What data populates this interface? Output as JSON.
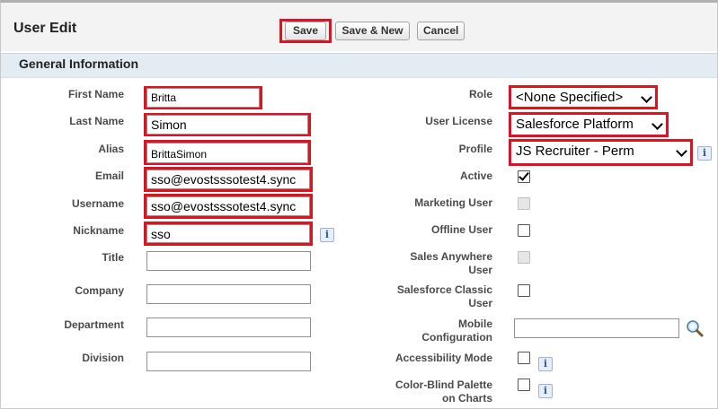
{
  "page": {
    "title": "User Edit",
    "section_title": "General Information"
  },
  "toolbar": {
    "save_label": "Save",
    "save_new_label": "Save & New",
    "cancel_label": "Cancel"
  },
  "left_fields": {
    "first_name": {
      "label": "First Name",
      "value": "Britta"
    },
    "last_name": {
      "label": "Last Name",
      "value": "Simon"
    },
    "alias": {
      "label": "Alias",
      "value": "BrittaSimon"
    },
    "email": {
      "label": "Email",
      "value": "sso@evostsssotest4.sync"
    },
    "username": {
      "label": "Username",
      "value": "sso@evostsssotest4.sync"
    },
    "nickname": {
      "label": "Nickname",
      "value": "sso"
    },
    "title": {
      "label": "Title",
      "value": ""
    },
    "company": {
      "label": "Company",
      "value": ""
    },
    "department": {
      "label": "Department",
      "value": ""
    },
    "division": {
      "label": "Division",
      "value": ""
    }
  },
  "right_fields": {
    "role": {
      "label": "Role",
      "value": "<None Specified>"
    },
    "user_license": {
      "label": "User License",
      "value": "Salesforce Platform"
    },
    "profile": {
      "label": "Profile",
      "value": "JS Recruiter - Perm"
    },
    "active": {
      "label": "Active",
      "checked": true
    },
    "marketing_user": {
      "label": "Marketing User",
      "checked": false,
      "disabled": true
    },
    "offline_user": {
      "label": "Offline User",
      "checked": false
    },
    "sales_anywhere_user": {
      "label_line1": "Sales Anywhere",
      "label_line2": "User",
      "checked": false,
      "disabled": true
    },
    "salesforce_classic_user": {
      "label_line1": "Salesforce Classic",
      "label_line2": "User",
      "checked": false
    },
    "mobile_configuration": {
      "label_line1": "Mobile",
      "label_line2": "Configuration",
      "value": ""
    },
    "accessibility_mode": {
      "label": "Accessibility Mode",
      "checked": false
    },
    "color_blind_palette": {
      "label_line1": "Color-Blind Palette",
      "label_line2": "on Charts",
      "checked": false
    }
  },
  "icons": {
    "info": "i",
    "lookup": "lookup-icon"
  },
  "colors": {
    "highlight": "#e0121f",
    "section_bar": "#e3ecf3",
    "header_bg": "#f3f3f3"
  }
}
